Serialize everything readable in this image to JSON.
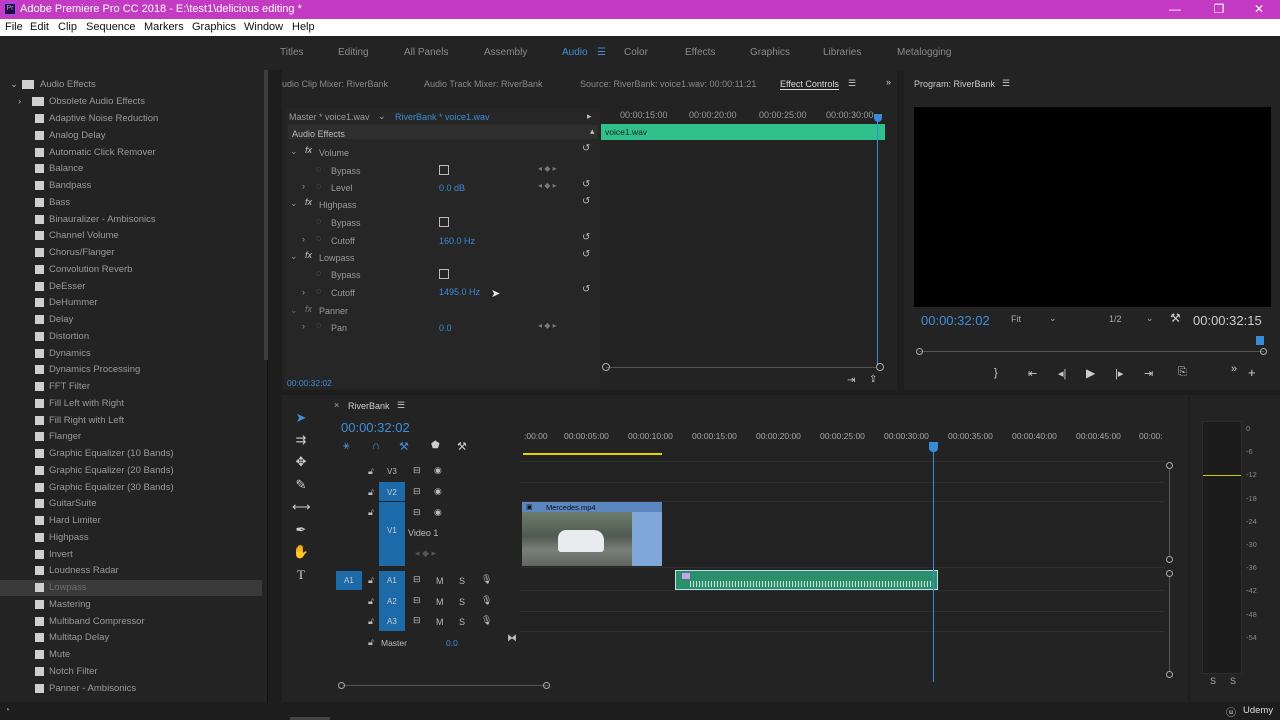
{
  "titlebar": {
    "title": "Adobe Premiere Pro CC 2018 - E:\\test1\\delicious editing *",
    "app_icon": "Pr",
    "min": "—",
    "max": "❐",
    "close": "✕"
  },
  "menu": [
    "File",
    "Edit",
    "Clip",
    "Sequence",
    "Markers",
    "Graphics",
    "Window",
    "Help"
  ],
  "workspaces": [
    "Titles",
    "Editing",
    "All Panels",
    "Assembly",
    "Audio",
    "Color",
    "Effects",
    "Graphics",
    "Libraries",
    "Metalogging"
  ],
  "active_workspace": "Audio",
  "effects_panel": {
    "folder": "Audio Effects",
    "subfolder": "Obsolete Audio Effects",
    "selected": "Lowpass",
    "items": [
      "Adaptive Noise Reduction",
      "Analog Delay",
      "Automatic Click Remover",
      "Balance",
      "Bandpass",
      "Bass",
      "Binauralizer - Ambisonics",
      "Channel Volume",
      "Chorus/Flanger",
      "Convolution Reverb",
      "DeEsser",
      "DeHummer",
      "Delay",
      "Distortion",
      "Dynamics",
      "Dynamics Processing",
      "FFT Filter",
      "Fill Left with Right",
      "Fill Right with Left",
      "Flanger",
      "Graphic Equalizer (10 Bands)",
      "Graphic Equalizer (20 Bands)",
      "Graphic Equalizer (30 Bands)",
      "GuitarSuite",
      "Hard Limiter",
      "Highpass",
      "Invert",
      "Loudness Radar",
      "Lowpass",
      "Mastering",
      "Multiband Compressor",
      "Multitap Delay",
      "Mute",
      "Notch Filter",
      "Panner - Ambisonics"
    ]
  },
  "panel_tabs": {
    "t1": "udio Clip Mixer: RiverBank",
    "t2": "Audio Track Mixer: RiverBank",
    "t3": "Source: RiverBank: voice1.wav: 00:00:11:21",
    "t4": "Effect Controls",
    "prog": "Program: RiverBank"
  },
  "effect_controls": {
    "master": "Master * voice1.wav",
    "clip": "RiverBank * voice1.wav",
    "header": "Audio Effects",
    "volume": "Volume",
    "bypass": "Bypass",
    "level": "Level",
    "level_val": "0.0 dB",
    "highpass": "Highpass",
    "cutoff": "Cutoff",
    "hp_val": "160.0 Hz",
    "lowpass": "Lowpass",
    "lp_val": "1495.0 Hz",
    "panner": "Panner",
    "pan": "Pan",
    "pan_val": "0.0",
    "timecode": "00:00:32:02",
    "clip_name": "voice1.wav",
    "ruler": [
      "00:00:15:00",
      "00:00:20:00",
      "00:00:25:00",
      "00:00:30:00"
    ]
  },
  "program": {
    "timecode": "00:00:32:02",
    "fit": "Fit",
    "res": "1/2",
    "duration": "00:00:32:15"
  },
  "timeline": {
    "seq": "RiverBank",
    "timecode": "00:00:32:02",
    "ruler": [
      ":00:00",
      "00:00:05:00",
      "00:00:10:00",
      "00:00:15:00",
      "00:00:20:00",
      "00:00:25:00",
      "00:00:30:00",
      "00:00:35:00",
      "00:00:40:00",
      "00:00:45:00",
      "00:00:"
    ],
    "tracks": {
      "v3": "V3",
      "v2": "V2",
      "v1": "V1",
      "video1": "Video 1",
      "a1": "A1",
      "a2": "A2",
      "a3": "A3",
      "master": "Master",
      "master_val": "0.0",
      "src": "A1",
      "m": "M",
      "s": "S"
    },
    "video_clip": "Mercedes.mp4"
  },
  "meter": {
    "ticks": [
      "0",
      "-6",
      "-12",
      "-18",
      "-24",
      "-30",
      "-36",
      "-42",
      "-48",
      "-54"
    ],
    "s1": "S",
    "s2": "S"
  },
  "watermark": "Udemy"
}
